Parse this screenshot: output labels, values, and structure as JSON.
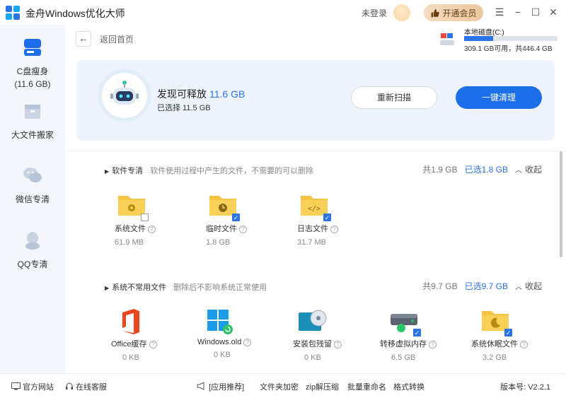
{
  "app": {
    "title": "金舟Windows优化大师",
    "not_logged_in": "未登录",
    "vip_label": "开通会员"
  },
  "sidebar": {
    "items": [
      {
        "label": "C盘瘦身",
        "sub": "(11.6 GB)"
      },
      {
        "label": "大文件搬家"
      },
      {
        "label": "微信专清"
      },
      {
        "label": "QQ专清"
      }
    ]
  },
  "header": {
    "back_label": "返回首页",
    "disk": {
      "name": "本地磁盘(C:)",
      "info": "309.1 GB可用，共446.4 GB",
      "used_fraction": 0.31
    }
  },
  "hero": {
    "title": "发现可释放",
    "amount": "11.6 GB",
    "selected": "已选择 11.5 GB",
    "rescan_label": "重新扫描",
    "clean_label": "一键清理"
  },
  "sections": [
    {
      "title": "软件专清",
      "desc": "软件使用过程中产生的文件，不需要的可以删除",
      "total": "共1.9 GB",
      "selected": "已选1.8 GB",
      "collapse": "收起",
      "items": [
        {
          "name": "系统文件",
          "size": "61.9 MB",
          "icon": "system-folder-icon",
          "checked": false
        },
        {
          "name": "临时文件",
          "size": "1.8 GB",
          "icon": "temp-folder-icon",
          "checked": true
        },
        {
          "name": "日志文件",
          "size": "31.7 MB",
          "icon": "log-folder-icon",
          "checked": true
        }
      ]
    },
    {
      "title": "系统不常用文件",
      "desc": "删除后不影响系统正常使用",
      "total": "共9.7 GB",
      "selected": "已选9.7 GB",
      "collapse": "收起",
      "items": [
        {
          "name": "Office缓存",
          "size": "0 KB",
          "icon": "office-icon",
          "checked": false
        },
        {
          "name": "Windows.old",
          "size": "0 KB",
          "icon": "windows-icon",
          "checked": false
        },
        {
          "name": "安装包残留",
          "size": "0 KB",
          "icon": "installer-disc-icon",
          "checked": false
        },
        {
          "name": "转移虚拟内存",
          "size": "6.5 GB",
          "icon": "hard-drive-icon",
          "checked": true
        },
        {
          "name": "系统休眠文件",
          "size": "3.2 GB",
          "icon": "sleep-folder-icon",
          "checked": true
        }
      ]
    }
  ],
  "footer": {
    "website": "官方网站",
    "support": "在线客服",
    "recommend": "[应用推荐]",
    "links": [
      "文件夹加密",
      "zip解压缩",
      "批量重命名",
      "格式转换"
    ],
    "version": "版本号: V2.2.1"
  },
  "colors": {
    "accent": "#1c6fe8",
    "folder": "#f6c342",
    "sidebar_bg": "#f3f6fb",
    "hero_bg": "#eef4fd"
  }
}
